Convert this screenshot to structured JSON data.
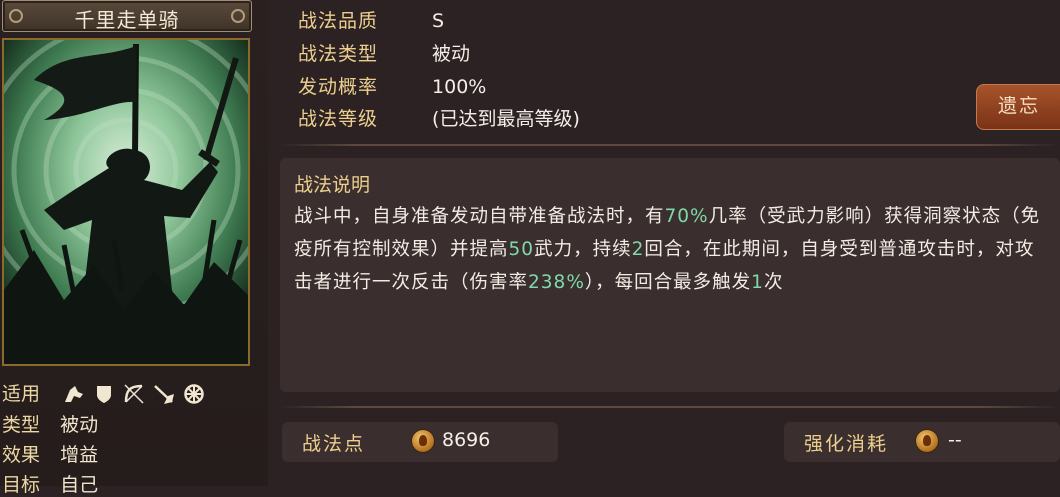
{
  "skill": {
    "name": "千里走单骑"
  },
  "attributes": {
    "applicable_label": "适用",
    "type_label": "类型",
    "type_value": "被动",
    "effect_label": "效果",
    "effect_value": "增益",
    "target_label": "目标",
    "target_value": "自己",
    "terrain_icons": [
      "cavalry-icon",
      "shield-icon",
      "bow-icon",
      "spear-icon",
      "wheel-icon"
    ]
  },
  "info": {
    "quality_label": "战法品质",
    "quality_value": "S",
    "category_label": "战法类型",
    "category_value": "被动",
    "chance_label": "发动概率",
    "chance_value": "100%",
    "level_label": "战法等级",
    "level_value": "(已达到最高等级)",
    "forget_button": "遗忘"
  },
  "description": {
    "title": "战法说明",
    "seg1": "战斗中，自身准备发动自带准备战法时，有",
    "hl1": "70%",
    "seg2": "几率（受武力影响）获得洞察状态（免疫所有控制效果）并提高",
    "hl2": "50",
    "seg3": "武力，持续",
    "hl3": "2",
    "seg4": "回合，在此期间，自身受到普通攻击时，对攻击者进行一次反击（伤害率",
    "hl4": "238%",
    "seg5": "），每回合最多触发",
    "hl5": "1",
    "seg6": "次"
  },
  "footer": {
    "points_label": "战法点",
    "points_value": "8696",
    "cost_label": "强化消耗",
    "cost_value": "--"
  },
  "colors": {
    "background": "#2c2223",
    "label_gold": "#eccf8e",
    "highlight_green": "#7fd9a8",
    "forget_button": "#8e421f",
    "panel": "#3b2e2e"
  }
}
